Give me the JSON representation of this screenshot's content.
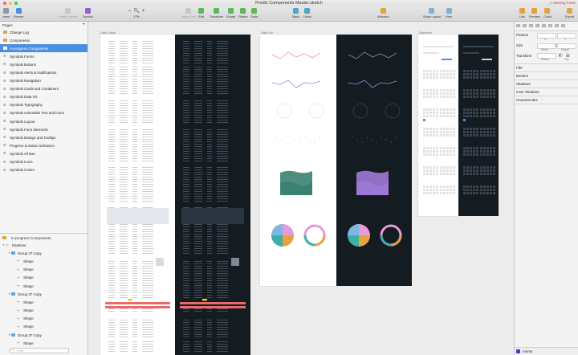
{
  "window": {
    "title": "Predix Components Master.sketch",
    "missing_fonts": "Missing Fonts"
  },
  "toolbar": {
    "insert": "Insert",
    "runner": "Runner",
    "create_symbol": "Create Symbol",
    "symbol": "Symbol",
    "zoom_minus": "–",
    "zoom_plus": "+",
    "zoom_value": "17%",
    "make_grid": "Make Grid",
    "edit": "Edit",
    "transform": "Transform",
    "rotate": "Rotate",
    "flatten": "Flatten",
    "scale": "Scale",
    "mask": "Mask",
    "union": "Union",
    "artboard": "Artboard",
    "show_layout": "Show Layout",
    "view": "View",
    "link": "Link",
    "preview": "Preview",
    "cloud": "Cloud",
    "export": "Export"
  },
  "pages_panel": {
    "header": "Pages",
    "add": "+",
    "pages": [
      {
        "label": "Change Log",
        "selected": false
      },
      {
        "label": "Components",
        "selected": false
      },
      {
        "label": "In-progress Components",
        "selected": true
      },
      {
        "label": "Symbols Forms",
        "selected": false
      },
      {
        "label": "Symbols Buttons",
        "selected": false
      },
      {
        "label": "Symbols Alerts & Notifications",
        "selected": false
      },
      {
        "label": "Symbols Navigation",
        "selected": false
      },
      {
        "label": "Symbols Cards and Containers",
        "selected": false
      },
      {
        "label": "Symbols Data Viz",
        "selected": false
      },
      {
        "label": "Symbols Typography",
        "selected": false
      },
      {
        "label": "Symbols Actionable Text and Icons",
        "selected": false
      },
      {
        "label": "Symbols Layout",
        "selected": false
      },
      {
        "label": "Symbols Form Elements",
        "selected": false
      },
      {
        "label": "Symbols Dialogs and Tooltips",
        "selected": false
      },
      {
        "label": "Progress & Status Indicators",
        "selected": false
      },
      {
        "label": "Symbols All Nav",
        "selected": false
      },
      {
        "label": "Symbols Icons",
        "selected": false
      },
      {
        "label": "Symbols Colors",
        "selected": false
      }
    ]
  },
  "layers_panel": {
    "header": "In-progress Components",
    "layers": [
      {
        "label": "Datetime",
        "level": 0,
        "kind": "artboard"
      },
      {
        "label": "Group 37 Copy",
        "level": 1,
        "kind": "group"
      },
      {
        "label": "Shape",
        "level": 2,
        "kind": "shape"
      },
      {
        "label": "Shape",
        "level": 2,
        "kind": "shape"
      },
      {
        "label": "Shape",
        "level": 2,
        "kind": "shape"
      },
      {
        "label": "Shape",
        "level": 2,
        "kind": "shape"
      },
      {
        "label": "Group 37 Copy",
        "level": 1,
        "kind": "group"
      },
      {
        "label": "Shape",
        "level": 2,
        "kind": "shape"
      },
      {
        "label": "Shape",
        "level": 2,
        "kind": "shape"
      },
      {
        "label": "Shape",
        "level": 2,
        "kind": "shape"
      },
      {
        "label": "Shape",
        "level": 2,
        "kind": "shape"
      },
      {
        "label": "Group 37 Copy",
        "level": 1,
        "kind": "group"
      },
      {
        "label": "Shape",
        "level": 2,
        "kind": "shape"
      }
    ],
    "filter_placeholder": "Filter"
  },
  "artboards": {
    "data_table": "Data Table",
    "data_viz": "Data Viz",
    "datetime": "Datetime"
  },
  "inspector": {
    "position": "Position",
    "x": "X",
    "y": "Y",
    "size": "Size",
    "width": "Width",
    "height": "Height",
    "transform": "Transform",
    "rotate": "Rotate",
    "flip": "Flip",
    "fills": "Fills",
    "borders": "Borders",
    "shadows": "Shadows",
    "inner_shadows": "Inner Shadows",
    "gaussian_blur": "Gaussian Blur"
  },
  "anima": {
    "label": "Anima"
  },
  "colors": {
    "selection": "#4a90e2",
    "dark_board": "#141b21",
    "teal_area": "#2e7a68",
    "purple_area": "#a67ee0",
    "missing_fonts": "#dd3333"
  }
}
